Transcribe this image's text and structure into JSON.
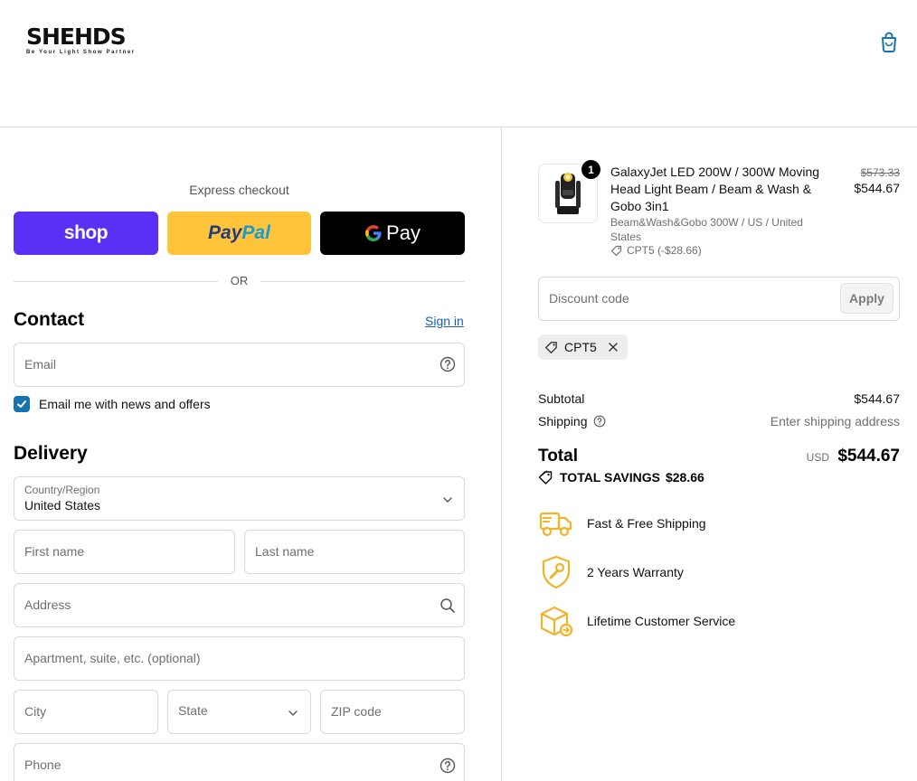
{
  "header": {
    "logo_text": "SHEHDS",
    "logo_tagline": "Be Your Light Show Partner",
    "bag_icon": "shopping-bag-icon"
  },
  "express": {
    "title": "Express checkout",
    "shop_label": "shop",
    "paypal_part1": "Pay",
    "paypal_part2": "Pal",
    "gpay_label": "Pay",
    "or_label": "OR"
  },
  "contact": {
    "title": "Contact",
    "sign_in": "Sign in",
    "email_placeholder": "Email",
    "newsletter_label": "Email me with news and offers",
    "newsletter_checked": true
  },
  "delivery": {
    "title": "Delivery",
    "country_label": "Country/Region",
    "country_value": "United States",
    "first_name_placeholder": "First name",
    "last_name_placeholder": "Last name",
    "address_placeholder": "Address",
    "apartment_placeholder": "Apartment, suite, etc. (optional)",
    "city_placeholder": "City",
    "state_label": "State",
    "zip_placeholder": "ZIP code",
    "phone_placeholder": "Phone"
  },
  "order": {
    "quantity": "1",
    "product_title": "GalaxyJet LED 200W / 300W Moving Head Light Beam / Beam & Wash & Gobo 3in1",
    "variant": "Beam&Wash&Gobo 300W / US / United States",
    "discount_line": "CPT5 (-$28.66)",
    "price_original": "$573.33",
    "price_current": "$544.67"
  },
  "discount": {
    "placeholder": "Discount code",
    "apply_label": "Apply",
    "applied_code": "CPT5"
  },
  "summary": {
    "subtotal_label": "Subtotal",
    "subtotal_value": "$544.67",
    "shipping_label": "Shipping",
    "shipping_value": "Enter shipping address",
    "total_label": "Total",
    "currency": "USD",
    "total_value": "$544.67",
    "savings_label": "TOTAL SAVINGS",
    "savings_value": "$28.66"
  },
  "features": [
    {
      "label": "Fast & Free Shipping",
      "icon": "delivery-truck-icon"
    },
    {
      "label": "2 Years Warranty",
      "icon": "shield-wrench-icon"
    },
    {
      "label": "Lifetime Customer Service",
      "icon": "box-return-icon"
    }
  ],
  "colors": {
    "shop_purple": "#5a31f4",
    "paypal_yellow": "#ffc439",
    "link_blue": "#1a5fb4",
    "checkbox_blue": "#1773b0",
    "feature_gold": "#f0b429"
  }
}
